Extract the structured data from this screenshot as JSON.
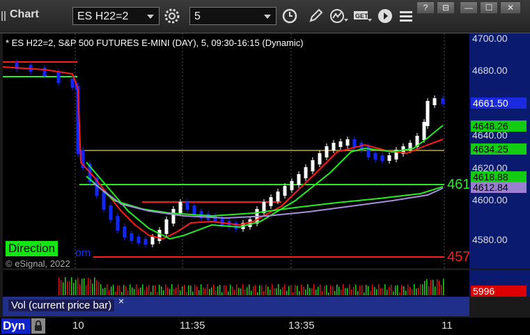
{
  "toolbar": {
    "title": "Chart",
    "symbol": "ES H22=2",
    "interval": "5",
    "win_help": "?",
    "win_restore": "⊟",
    "win_min": "—",
    "win_max": "☐",
    "win_close": "✕"
  },
  "chart": {
    "header": "* ES H22=2, S&P 500 FUTURES E-MINI (DAY), 5, 09:30-16:15 (Dynamic)",
    "copyright": "© eSignal, 2022",
    "direction_label": "Direction",
    "direction_partial": "om",
    "overflow_label_green": "461",
    "overflow_label_red": "457",
    "price_ticks": [
      "4700.00",
      "4680.00",
      "4660.00",
      "4640.00",
      "4620.00",
      "4600.00",
      "4580.00"
    ],
    "tags": [
      {
        "text": "4661.50",
        "bg": "#1a2adf",
        "fg": "#ffffff"
      },
      {
        "text": "4648.26",
        "bg": "#12cc12",
        "fg": "#000000"
      },
      {
        "text": "4634.25",
        "bg": "#12cc12",
        "fg": "#000000"
      },
      {
        "text": "4618.88",
        "bg": "#12cc12",
        "fg": "#000000"
      },
      {
        "text": "4612.84",
        "bg": "#9a7fd0",
        "fg": "#000000"
      }
    ],
    "time_labels": [
      "10",
      "11:35",
      "13:35",
      "11"
    ],
    "colors": {
      "up": "#ffffff",
      "down": "#1028ff",
      "red": "#ff1a1a",
      "green": "#22ee22",
      "purple": "#a98ee0"
    }
  },
  "volume": {
    "label": "Vol (current price bar)",
    "close": "×",
    "value": "5996",
    "value_bg": "#dd0000"
  },
  "footer": {
    "dyn": "Dyn"
  }
}
